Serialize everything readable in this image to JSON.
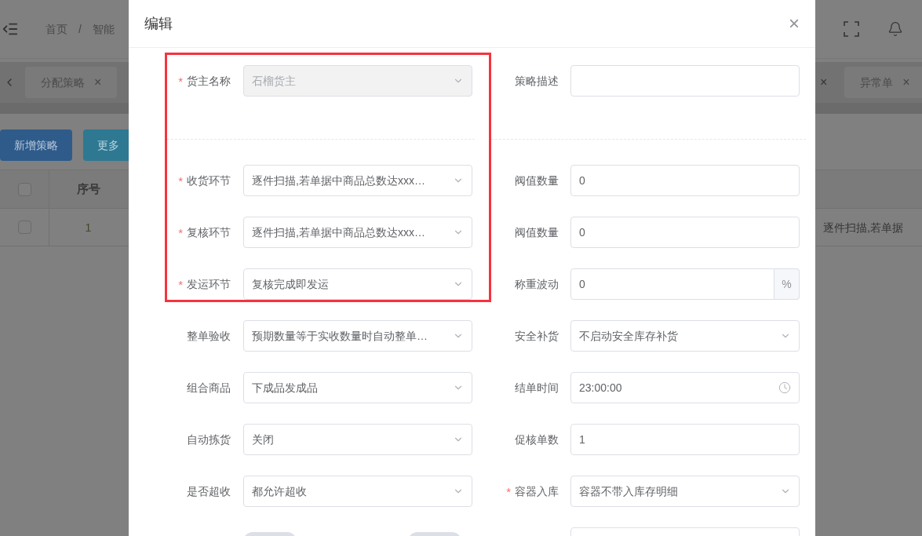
{
  "background": {
    "breadcrumb": [
      "首页",
      "/",
      "智能"
    ],
    "tabs_left": [
      {
        "label": "分配策略",
        "close": "×"
      }
    ],
    "tabs_right": [
      {
        "label": "异常单",
        "close": "×"
      }
    ],
    "buttons": [
      {
        "label": "新增策略",
        "kind": "primary"
      },
      {
        "label": "更多",
        "kind": "info"
      }
    ],
    "table": {
      "header": {
        "checked": false,
        "column_2": "序号"
      },
      "rows": [
        {
          "checked": false,
          "column_2": "1",
          "column_last": "逐件扫描,若单据"
        }
      ]
    }
  },
  "dialog": {
    "title": "编辑",
    "close": "×",
    "sections": [
      [
        {
          "left": {
            "label": "货主名称",
            "mark": "*",
            "kind": "select",
            "value": "石榴货主",
            "disabled": true
          },
          "right": {
            "label": "策略描述",
            "kind": "input"
          }
        }
      ],
      [
        {
          "left": {
            "label": "收货环节",
            "mark": "*",
            "kind": "select",
            "value": "逐件扫描,若单据中商品总数达xxx…"
          },
          "right": {
            "label": "阀值数量",
            "kind": "input",
            "value": "0"
          }
        },
        {
          "left": {
            "label": "复核环节",
            "mark": "*",
            "kind": "select",
            "value": "逐件扫描,若单据中商品总数达xxx…"
          },
          "right": {
            "label": "阀值数量",
            "kind": "input",
            "value": "0"
          }
        },
        {
          "left": {
            "label": "发运环节",
            "mark": "*",
            "kind": "select",
            "value": "复核完成即发运"
          },
          "right": {
            "label": "称重波动",
            "kind": "suffix",
            "value": "0",
            "suffix": "%"
          }
        },
        {
          "left": {
            "label": "整单验收",
            "kind": "select",
            "value": "预期数量等于实收数量时自动整单…"
          },
          "right": {
            "label": "安全补货",
            "kind": "select",
            "value": "不启动安全库存补货"
          }
        },
        {
          "left": {
            "label": "组合商品",
            "kind": "select",
            "value": "下成品发成品"
          },
          "right": {
            "label": "结单时间",
            "kind": "time",
            "value": "23:00:00"
          }
        },
        {
          "left": {
            "label": "自动拣货",
            "kind": "select",
            "value": "关闭"
          },
          "right": {
            "label": "促核单数",
            "kind": "input",
            "value": "1"
          }
        },
        {
          "left": {
            "label": "是否超收",
            "kind": "select",
            "value": "都允许超收"
          },
          "right": {
            "label": "容器入库",
            "mark": "*",
            "kind": "select",
            "value": "容器不带入库存明细"
          }
        },
        {
          "left": {
            "kind": "switches",
            "switches": [
              {
                "on": false
              },
              {
                "on": false
              }
            ]
          },
          "right": {
            "kind": "input"
          }
        }
      ]
    ]
  }
}
